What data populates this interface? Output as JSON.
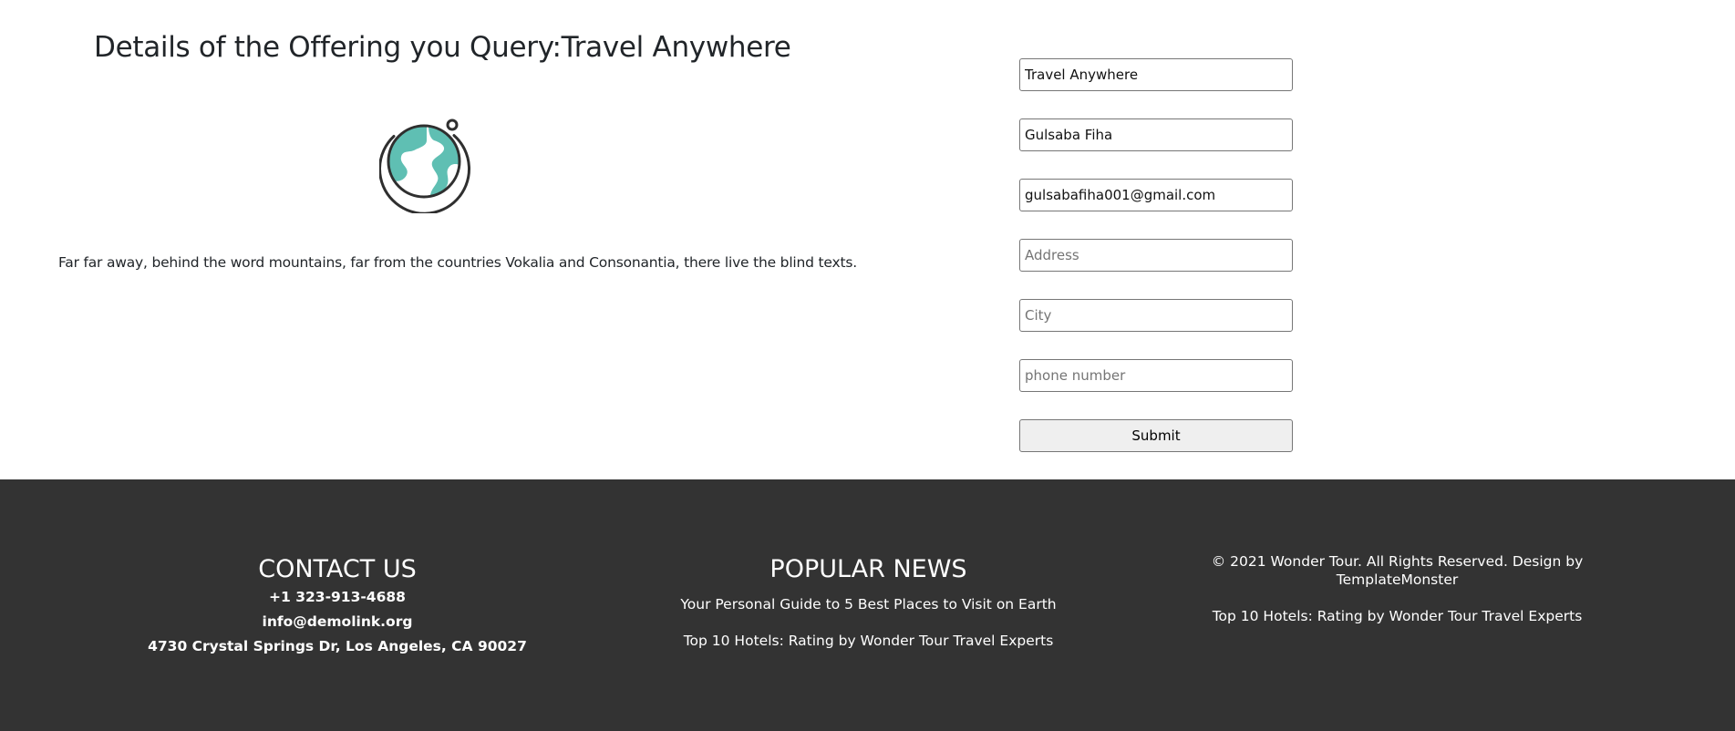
{
  "offering": {
    "title": "Details of the Offering you Query:Travel Anywhere",
    "description": "Far far away, behind the word mountains, far from the countries Vokalia and Consonantia, there live the blind texts.",
    "icon": "globe-icon",
    "icon_color": "#5fbfb3"
  },
  "form": {
    "offering_value": "Travel Anywhere",
    "name_value": "Gulsaba Fiha",
    "email_value": "gulsabafiha001@gmail.com",
    "address_placeholder": "Address",
    "city_placeholder": "City",
    "phone_placeholder": "phone number",
    "submit_label": "Submit"
  },
  "footer": {
    "background": "#333333",
    "contact": {
      "heading": "CONTACT US",
      "phone": "+1 323-913-4688",
      "email": "info@demolink.org",
      "address": "4730 Crystal Springs Dr, Los Angeles, CA 90027"
    },
    "news": {
      "heading": "POPULAR NEWS",
      "items": [
        "Your Personal Guide to 5 Best Places to Visit on Earth",
        "Top 10 Hotels: Rating by Wonder Tour Travel Experts"
      ]
    },
    "copyright": {
      "text": "© 2021 Wonder Tour. All Rights Reserved. Design by TemplateMonster",
      "link": "Top 10 Hotels: Rating by Wonder Tour Travel Experts"
    }
  }
}
